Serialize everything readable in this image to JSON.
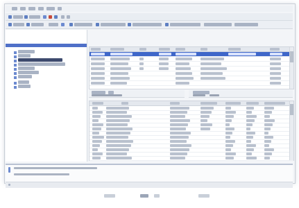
{
  "colors": {
    "accent_blue": "#4f70c8",
    "selection_blue": "#3f67c9",
    "window_bg": "#f3f5f8",
    "panel_white": "#ffffff"
  },
  "icons": {
    "toolbar_icons": [
      "back-icon",
      "forward-icon",
      "refresh-icon",
      "grid-icon",
      "search-icon"
    ],
    "tree_item_icon": "folder-icon"
  },
  "top_grid": {
    "row_count": 7
  },
  "bottom_grid": {
    "row_count": 13
  },
  "tree": {
    "item_count": 11
  }
}
